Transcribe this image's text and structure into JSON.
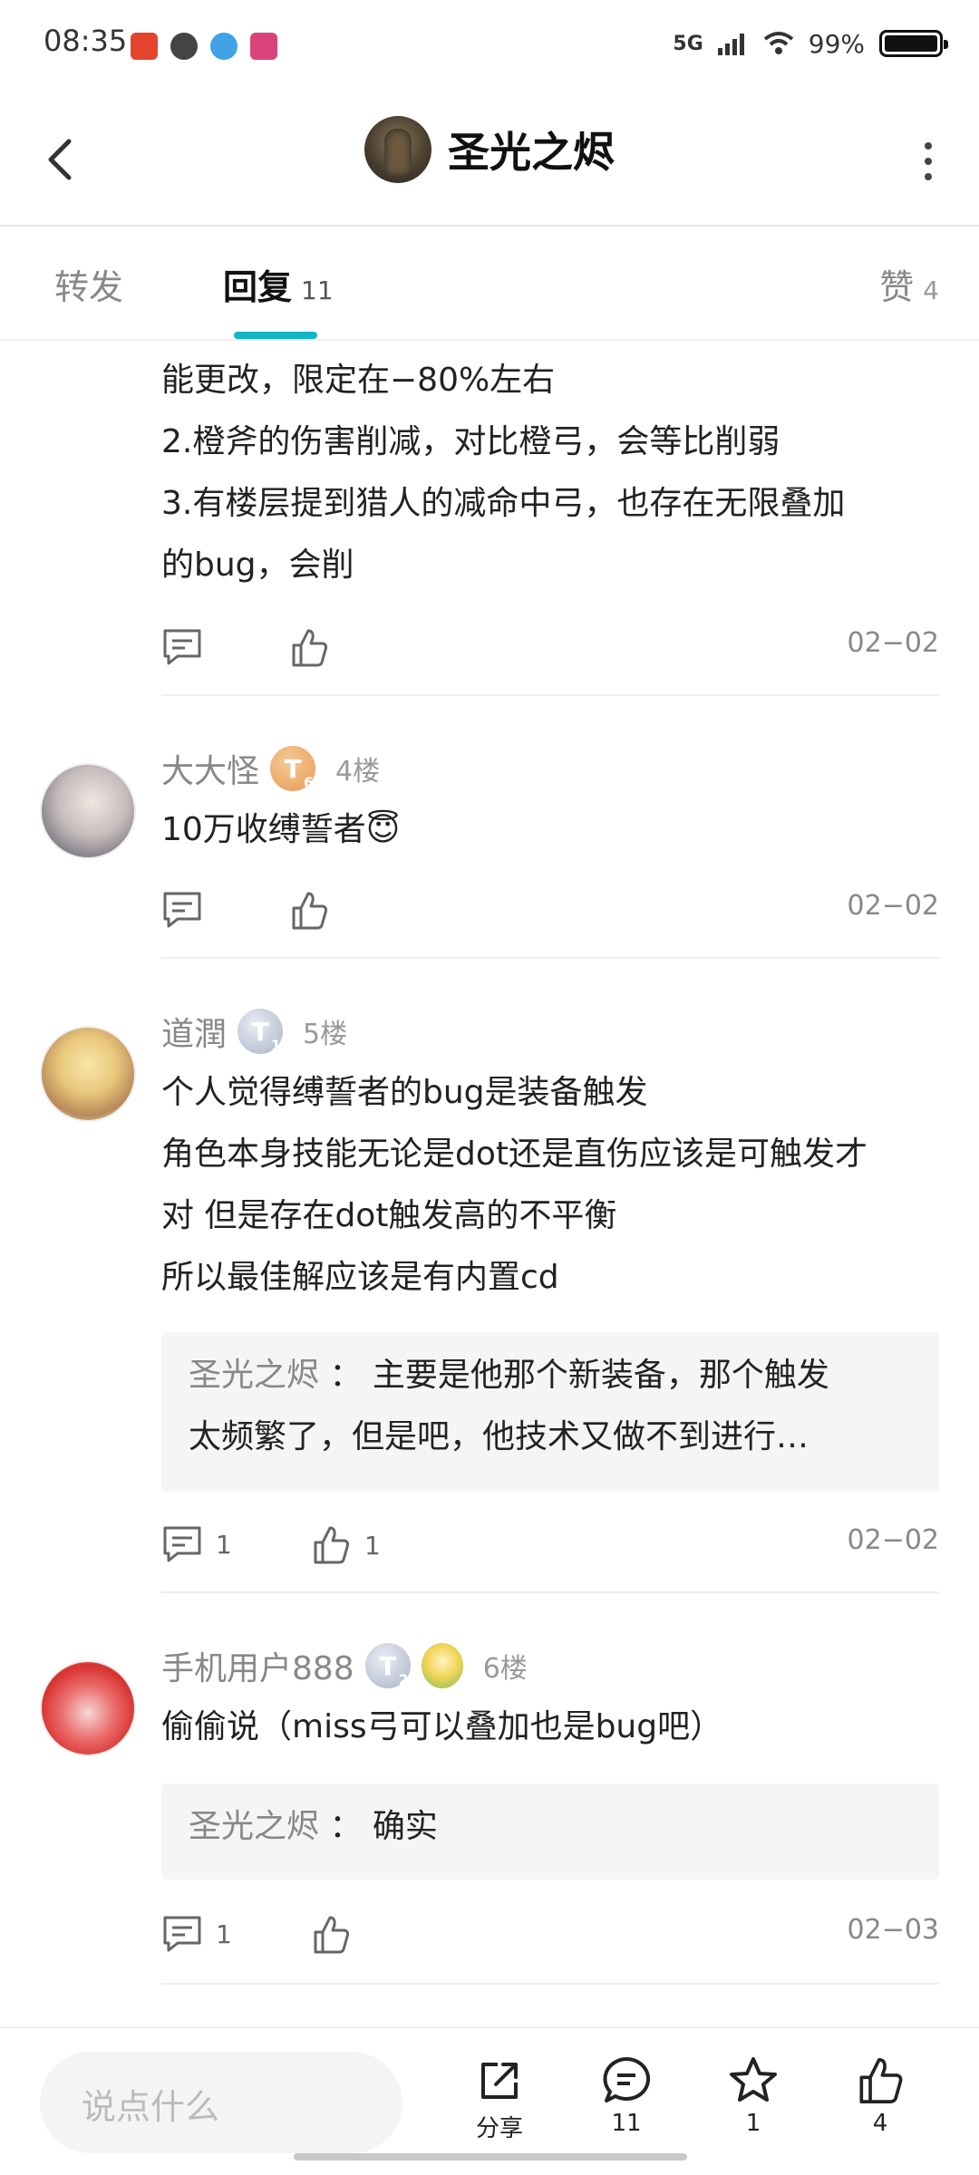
{
  "status_bar": {
    "time": "08:35",
    "network": "5G",
    "battery": "99%"
  },
  "header": {
    "title": "圣光之烬"
  },
  "tabs": [
    {
      "label": "转发",
      "count": ""
    },
    {
      "label": "回复",
      "count": "11"
    },
    {
      "label": "赞",
      "count": "4"
    }
  ],
  "posts": [
    {
      "lines": [
        "能更改，限定在−80%左右",
        "2.橙斧的伤害削减，对比橙弓，会等比削弱",
        "3.有楼层提到猎人的减命中弓，也存在无限叠加",
        "的bug，会削"
      ],
      "comment_count": "",
      "like_count": "",
      "date": "02−02"
    },
    {
      "user": "大大怪",
      "badge": "T",
      "badge_level": "6",
      "floor": "4楼",
      "lines": [
        "10万收缚誓者😇"
      ],
      "comment_count": "",
      "like_count": "",
      "date": "02−02"
    },
    {
      "user": "道潤",
      "badge": "T",
      "badge_level": "1",
      "floor": "5楼",
      "lines": [
        "个人觉得缚誓者的bug是装备触发",
        "角色本身技能无论是dot还是直伤应该是可触发才",
        "对  但是存在dot触发高的不平衡",
        "所以最佳解应该是有内置cd"
      ],
      "quote": {
        "author": "圣光之烬",
        "sep": " ： ",
        "lines": [
          "主要是他那个新装备，那个触发",
          "太频繁了，但是吧，他技术又做不到进行…"
        ]
      },
      "comment_count": "1",
      "like_count": "1",
      "date": "02−02"
    },
    {
      "user": "手机用户888",
      "badge": "T",
      "badge_level": "2",
      "floor": "6楼",
      "lines": [
        "偷偷说（miss弓可以叠加也是bug吧）"
      ],
      "quote": {
        "author": "圣光之烬",
        "sep": " ： ",
        "lines": [
          "确实"
        ]
      },
      "comment_count": "1",
      "like_count": "",
      "date": "02−03"
    }
  ],
  "bottom_bar": {
    "input_placeholder": "说点什么",
    "share_label": "分享",
    "comment_count": "11",
    "fav_count": "1",
    "like_count": "4"
  }
}
